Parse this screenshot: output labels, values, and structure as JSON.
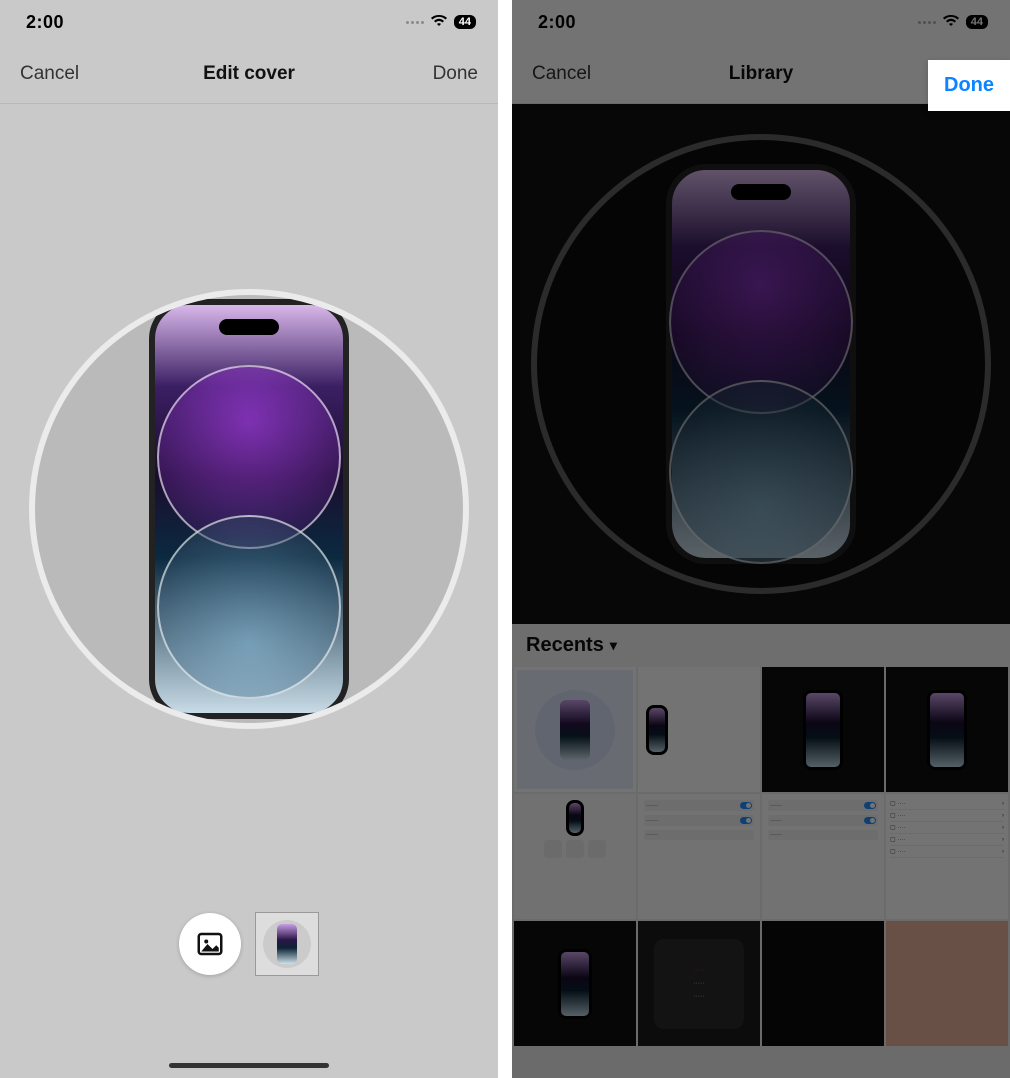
{
  "status": {
    "time": "2:00",
    "batteryText": "44"
  },
  "leftPanel": {
    "nav": {
      "cancel": "Cancel",
      "title": "Edit cover",
      "done": "Done"
    }
  },
  "rightPanel": {
    "nav": {
      "cancel": "Cancel",
      "title": "Library",
      "done": "Done"
    },
    "sections": {
      "recents": "Recents"
    },
    "doneHighlight": "Done"
  }
}
